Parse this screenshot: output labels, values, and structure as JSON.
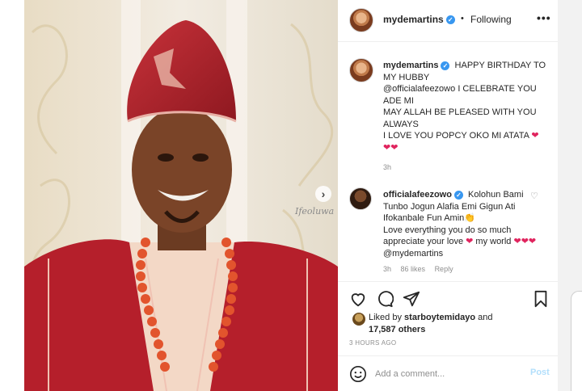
{
  "header": {
    "username": "mydemartins",
    "separator": "•",
    "follow_status": "Following",
    "more_icon": "more-horizontal-icon"
  },
  "caption": {
    "username": "mydemartins",
    "line1": "HAPPY BIRTHDAY TO MY HUBBY",
    "mention": "@officialafeezowo",
    "line2": "I CELEBRATE YOU ADE MI",
    "line3": "MAY ALLAH BE PLEASED WITH YOU ALWAYS",
    "line4": "I LOVE YOU POPCY OKO MI ATATA",
    "hearts_inline": "❤",
    "hearts_after": "❤❤",
    "time": "3h"
  },
  "comment": {
    "username": "officialafeezowo",
    "text1": "Kolohun Bami Tunbo Jogun Alafia Emi Gigun Ati Ifokanbale Fun Amin",
    "emoji": "👏",
    "text2": "Love everything you do so much appreciate your love",
    "heart1": "❤",
    "text3": "my world",
    "hearts2": "❤❤❤",
    "mention": "@mydemartins",
    "time": "3h",
    "likes": "86 likes",
    "reply": "Reply"
  },
  "actions": {
    "like_icon": "heart-outline-icon",
    "comment_icon": "comment-bubble-icon",
    "share_icon": "paper-plane-icon",
    "save_icon": "bookmark-icon"
  },
  "likes": {
    "prefix": "Liked by",
    "user": "starboytemidayo",
    "and": "and",
    "others": "17,587 others"
  },
  "post_time": "3 HOURS AGO",
  "add_comment": {
    "placeholder": "Add a comment...",
    "post_label": "Post",
    "emoji_icon": "smiley-icon"
  },
  "photo": {
    "watermark": "Ifeoluwa",
    "next_icon": "chevron-right-icon",
    "next_glyph": "›"
  },
  "colors": {
    "verified": "#3897f0",
    "heart": "#e0245e",
    "muted": "#8e8e8e",
    "post_disabled": "#b2dffc",
    "agbada_red": "#b51f2b"
  }
}
